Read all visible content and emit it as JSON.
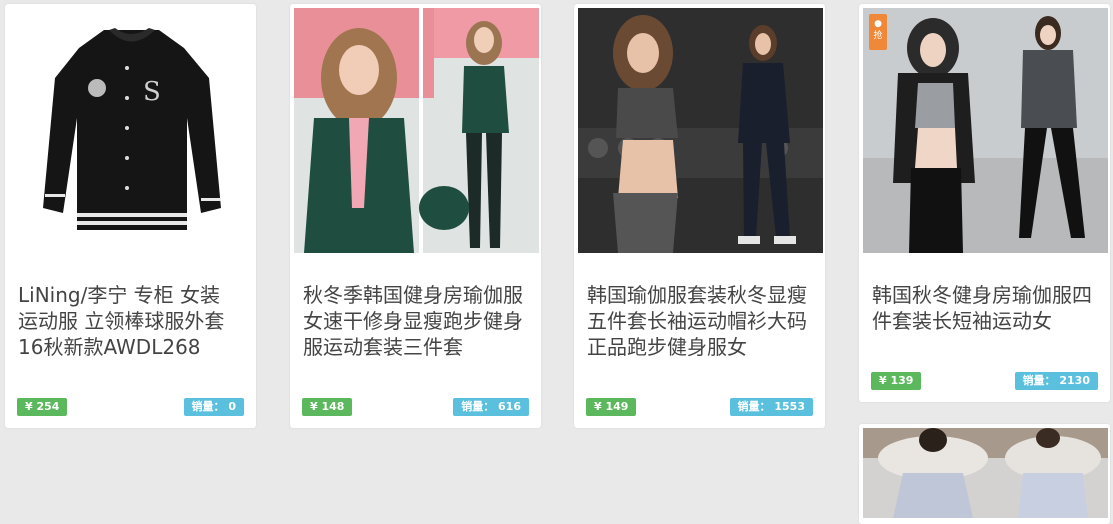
{
  "products": [
    {
      "title": "LiNing/李宁 专柜 女装 运动服 立领棒球服外套 16秋新款AWDL268",
      "price": "¥ 254",
      "sales": "销量： 0",
      "image": "black-baseball-jacket"
    },
    {
      "title": "秋冬季韩国健身房瑜伽服女速干修身显瘦跑步健身服运动套装三件套",
      "price": "¥ 148",
      "sales": "销量： 616",
      "image": "green-sports-suit"
    },
    {
      "title": "韩国瑜伽服套装秋冬显瘦五件套长袖运动帽衫大码正品跑步健身服女",
      "price": "¥ 149",
      "sales": "销量： 1553",
      "image": "camo-yoga-set"
    },
    {
      "title": "韩国秋冬健身房瑜伽服四件套装长短袖运动女",
      "price": "¥ 139",
      "sales": "销量： 2130",
      "image": "grey-hooded-set",
      "badge": "❤\n抢"
    },
    {
      "title": "",
      "price": "",
      "sales": "",
      "image": "fur-collar-coat"
    }
  ],
  "colors": {
    "price_badge": "#5cb85c",
    "sales_badge": "#5bc0de",
    "background": "#e9e9e9"
  }
}
